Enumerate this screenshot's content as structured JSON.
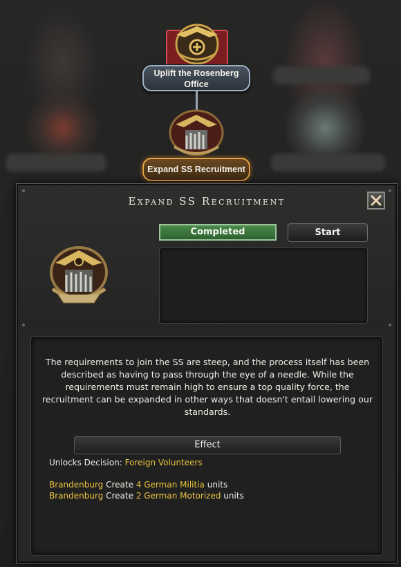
{
  "focus_tree": {
    "parent_node": {
      "label": "Uplift the Rosenberg\nOffice",
      "icon": "eagle-wreath-emblem-icon"
    },
    "selected_node": {
      "label": "Expand SS Recruitment",
      "icon": "ss-soldiers-emblem-icon"
    }
  },
  "dialog": {
    "title": "Expand SS Recruitment",
    "close_icon": "close-x-icon",
    "status_label": "Completed",
    "start_label": "Start",
    "icon": "ss-soldiers-emblem-icon",
    "description": "The requirements to join the SS are steep, and the process itself has been described as having to pass through the eye of a needle. While the requirements must remain high to ensure a top quality force, the recruitment can be expanded in other ways that doesn't entail lowering our standards.",
    "effect_header": "Effect",
    "effects": {
      "unlock_prefix": "Unlocks Decision:",
      "unlock_value": "Foreign Volunteers",
      "line1": {
        "state": "Brandenburg",
        "verb": "Create",
        "amount": "4 German Militia",
        "suffix": "units"
      },
      "line2": {
        "state": "Brandenburg",
        "verb": "Create",
        "amount": "2 German Motorized",
        "suffix": "units"
      }
    }
  },
  "colors": {
    "completed_green": "#3d7a3f",
    "highlight_gold": "#e9c440",
    "node_gold_border": "#e6a64a",
    "node_blue_border": "#9fb3c4"
  }
}
